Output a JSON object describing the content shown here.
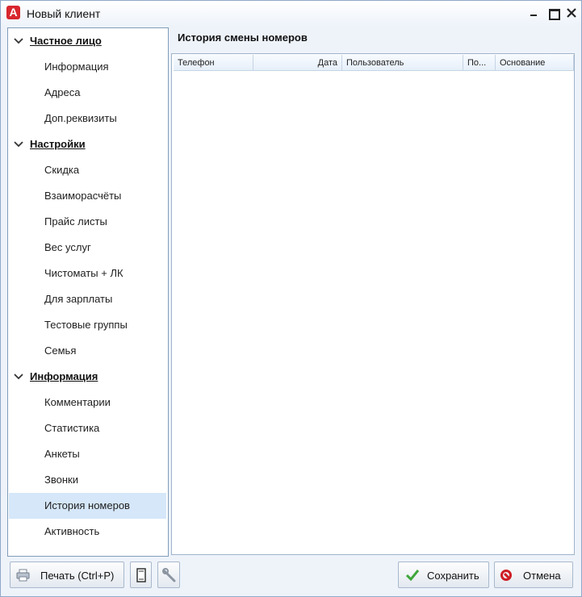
{
  "window": {
    "title": "Новый клиент",
    "logo_letter": "А",
    "accent": "#d8262e"
  },
  "sidebar": {
    "groups": [
      {
        "label": "Частное лицо",
        "items": [
          "Информация",
          "Адреса",
          "Доп.реквизиты"
        ]
      },
      {
        "label": "Настройки",
        "items": [
          "Скидка",
          "Взаиморасчёты",
          "Прайс листы",
          "Вес услуг",
          "Чистоматы + ЛК",
          "Для зарплаты",
          "Тестовые группы",
          "Семья"
        ]
      },
      {
        "label": "Информация",
        "items": [
          "Комментарии",
          "Статистика",
          "Анкеты",
          "Звонки",
          "История номеров",
          "Активность"
        ]
      }
    ],
    "active_item": "История номеров",
    "active_color": "#d5e7f9"
  },
  "main": {
    "title": "История смены номеров",
    "columns": [
      "Телефон",
      "Дата",
      "Пользователь",
      "По...",
      "Основание"
    ]
  },
  "toolbar": {
    "print_label": "Печать (Ctrl+P)",
    "save_label": "Сохранить",
    "cancel_label": "Отмена",
    "icons": [
      "printer-icon",
      "document-icon",
      "wrench-icon",
      "checkmark-icon",
      "cancel-icon"
    ]
  }
}
